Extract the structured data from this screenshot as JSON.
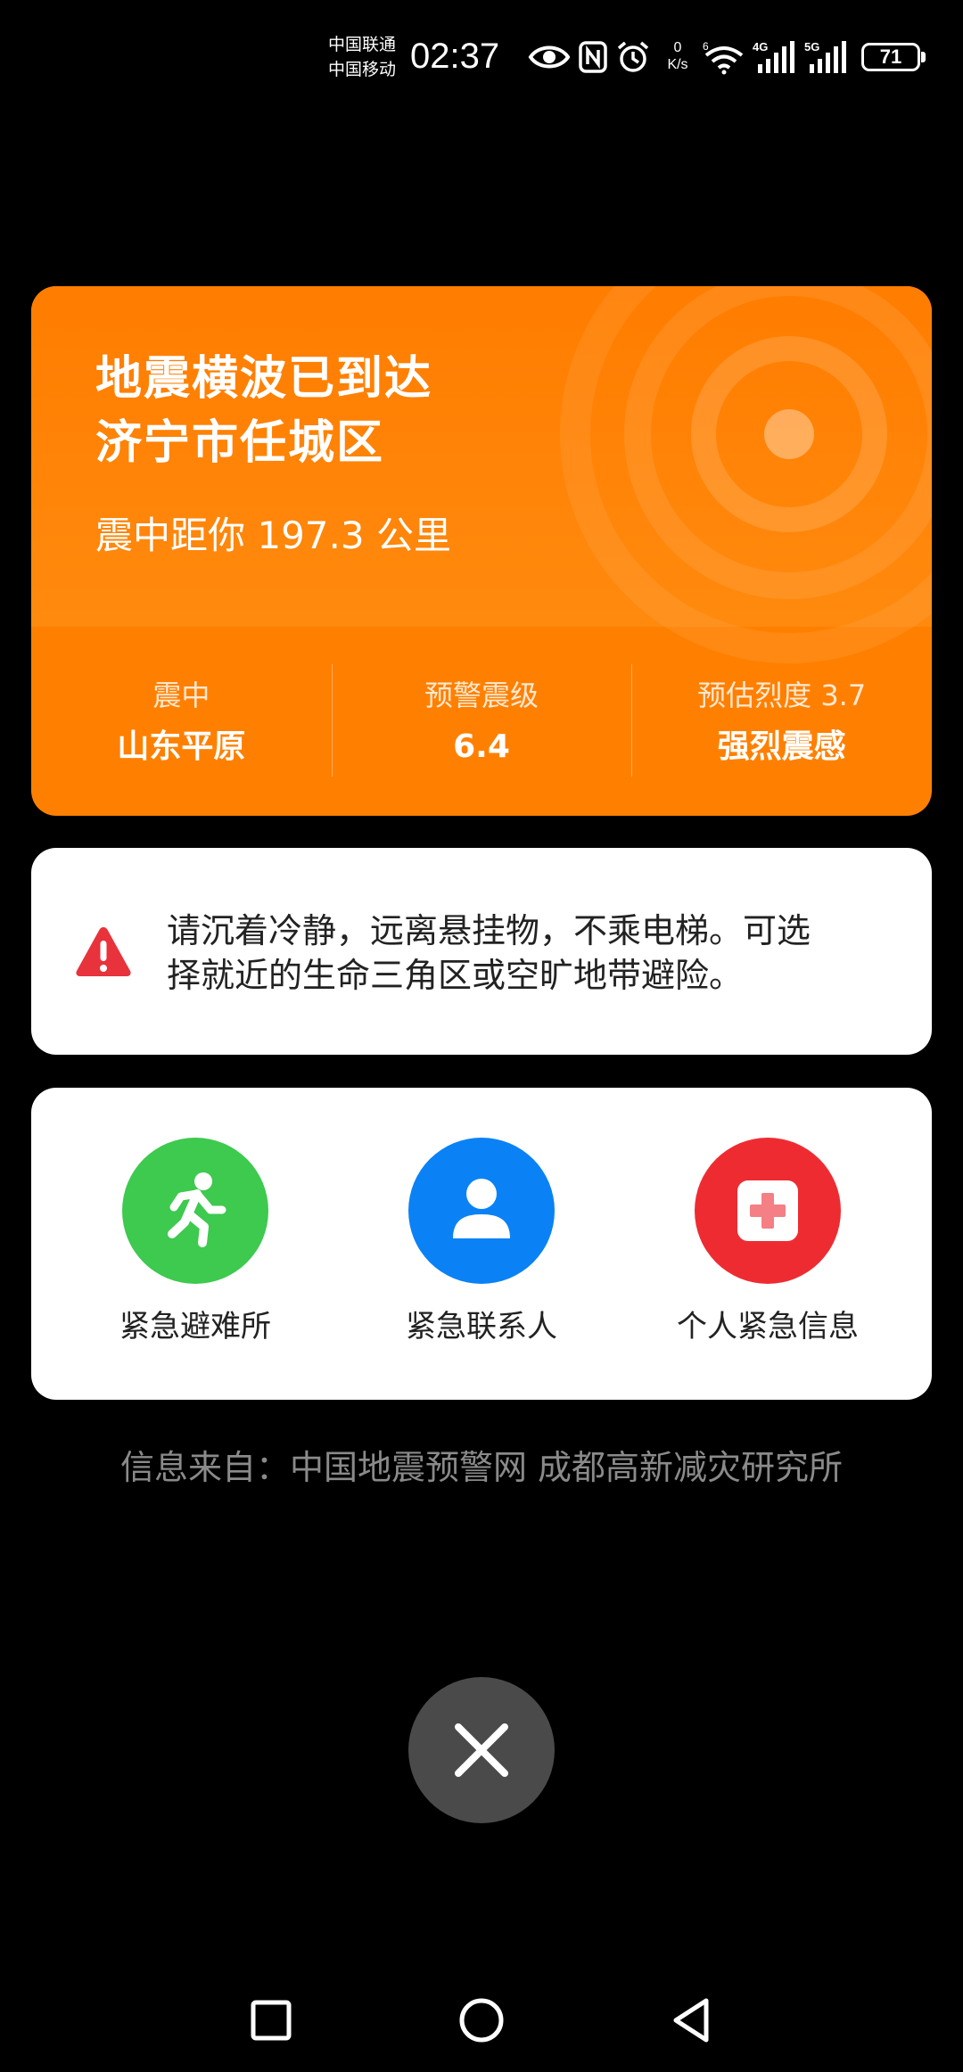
{
  "status_bar": {
    "carrier_1": "中国联通",
    "carrier_2": "中国移动",
    "time": "02:37",
    "net_speed_value": "0",
    "net_speed_unit": "K/s",
    "wifi_tag": "6",
    "signal_1_tag": "4G",
    "signal_2_tag": "5G",
    "battery_level": "71",
    "icons": [
      "eye-icon",
      "nfc-icon",
      "alarm-icon",
      "wifi-icon",
      "signal-icon",
      "signal-icon",
      "battery-icon"
    ]
  },
  "alert": {
    "title_line1": "地震横波已到达",
    "title_line2": "济宁市任城区",
    "distance": "震中距你 197.3 公里",
    "stats": [
      {
        "label": "震中",
        "value": "山东平原"
      },
      {
        "label": "预警震级",
        "value": "6.4"
      },
      {
        "label": "预估烈度 3.7",
        "value": "强烈震感"
      }
    ],
    "color": "#ff8000"
  },
  "advice": {
    "icon": "warning-icon",
    "text_line1": "请沉着冷静，远离悬挂物，不乘电梯。可选",
    "text_line2": "择就近的生命三角区或空旷地带避险。",
    "icon_color": "#e8323c"
  },
  "actions": [
    {
      "label": "紧急避难所",
      "icon": "running-person-icon",
      "color": "#3ec94f"
    },
    {
      "label": "紧急联系人",
      "icon": "person-icon",
      "color": "#0a82f5"
    },
    {
      "label": "个人紧急信息",
      "icon": "medical-cross-icon",
      "color": "#ef2b32"
    }
  ],
  "source": "信息来自：中国地震预警网 成都高新减灾研究所",
  "close": {
    "icon": "close-icon"
  },
  "nav": {
    "icons": [
      "recents-square-icon",
      "home-circle-icon",
      "back-triangle-icon"
    ]
  }
}
